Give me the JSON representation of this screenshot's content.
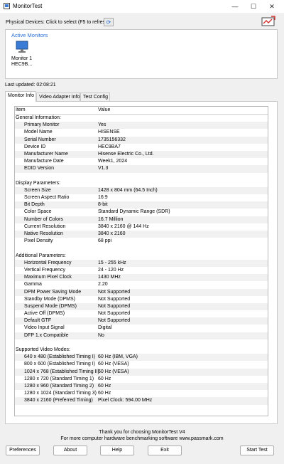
{
  "window": {
    "title": "MonitorTest"
  },
  "window_controls": {
    "minimize": "—",
    "maximize": "☐",
    "close": "✕"
  },
  "physical_devices": {
    "label": "Physical Devices: Click to select (F5 to refresh)"
  },
  "active_monitors": {
    "title": "Active Monitors",
    "monitors": [
      {
        "line1": "Monitor 1",
        "line2": "HEC9B..."
      }
    ]
  },
  "last_updated": "Last updated: 02:08:21",
  "tabs": [
    "Monitor Info",
    "Video Adapter Info",
    "Test Config"
  ],
  "grid": {
    "header": {
      "item": "Item",
      "value": "Value"
    },
    "sections": [
      {
        "title": "General Information:",
        "rows": [
          [
            "Primary Monitor",
            "Yes"
          ],
          [
            "Model Name",
            "HISENSE"
          ],
          [
            "Serial Number",
            "1735156332"
          ],
          [
            "Device ID",
            "HEC9BA7"
          ],
          [
            "Manufacturer Name",
            "Hisense Electric Co., Ltd."
          ],
          [
            "Manufacture Date",
            "Week1, 2024"
          ],
          [
            "EDID Version",
            "V1.3"
          ]
        ]
      },
      {
        "title": "Display Parameters:",
        "rows": [
          [
            "Screen Size",
            "1428 x 804 mm (64.5 Inch)"
          ],
          [
            "Screen Aspect Ratio",
            "16:9"
          ],
          [
            "Bit Depth",
            "8-bit"
          ],
          [
            "Color Space",
            "Standard Dynamic Range (SDR)"
          ],
          [
            "Number of Colors",
            "16.7 Million"
          ],
          [
            "Current Resolution",
            "3840 x 2160 @ 144 Hz"
          ],
          [
            "Native Resolution",
            "3840 x 2160"
          ],
          [
            "Pixel Density",
            "68 ppi"
          ]
        ]
      },
      {
        "title": "Additional Parameters:",
        "rows": [
          [
            "Horizontal Frequency",
            "15 - 255 kHz"
          ],
          [
            "Vertical Frequency",
            "24 - 120 Hz"
          ],
          [
            "Maximum Pixel Clock",
            "1430 MHz"
          ],
          [
            "Gamma",
            "2.20"
          ],
          [
            "DPM Power Saving Mode",
            "Not Supported"
          ],
          [
            "Standby Mode (DPMS)",
            "Not Supported"
          ],
          [
            "Suspend Mode (DPMS)",
            "Not Supported"
          ],
          [
            "Active Off (DPMS)",
            "Not Supported"
          ],
          [
            "Default GTF",
            "Not Supported"
          ],
          [
            "Video Input Signal",
            "Digital"
          ],
          [
            "DFP 1.x Compatible",
            "No"
          ]
        ]
      },
      {
        "title": "Supported Video Modes:",
        "rows": [
          [
            "640 x 480 (Established Timing I)",
            "60 Hz (IBM, VGA)"
          ],
          [
            "800 x 600 (Established Timing I)",
            "60 Hz (VESA)"
          ],
          [
            "1024 x 768 (Established Timing II)",
            "60 Hz (VESA)"
          ],
          [
            "1280 x 720 (Standard Timing 1)",
            "60 Hz"
          ],
          [
            "1280 x 960 (Standard Timing 2)",
            "60 Hz"
          ],
          [
            "1280 x 1024 (Standard Timing 3)",
            "60 Hz"
          ],
          [
            "3840 x 2160 (Preferred Timing)",
            "Pixel Clock: 594.00 MHz"
          ]
        ]
      }
    ]
  },
  "footer": {
    "line1": "Thank you for choosing MonitorTest V4",
    "line2": "For more computer hardware benchmarking software www.passmark.com"
  },
  "buttons": {
    "preferences": "Preferences",
    "about": "About",
    "help": "Help",
    "exit": "Exit",
    "start_test": "Start Test"
  }
}
